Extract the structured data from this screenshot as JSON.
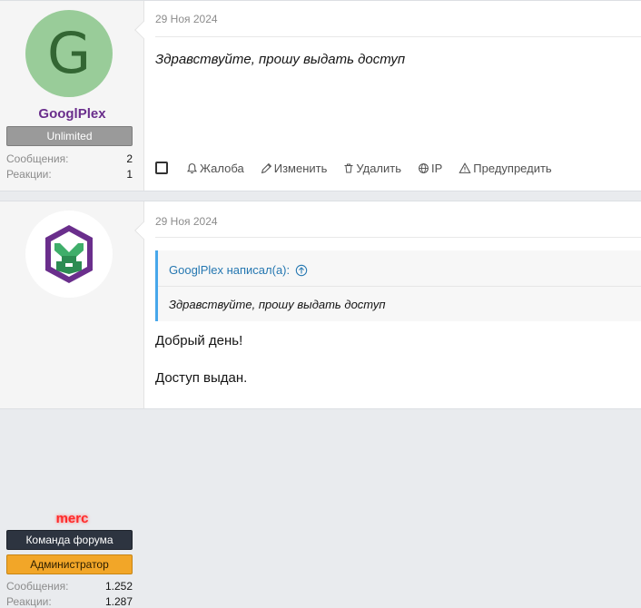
{
  "posts": [
    {
      "user": {
        "avatar_letter": "G",
        "avatar_color": "#99cc99",
        "name": "GooglPlex",
        "name_color": "#6a2e8c",
        "banners": [
          "Unlimited"
        ],
        "stats": [
          {
            "label": "Сообщения:",
            "value": "2"
          },
          {
            "label": "Реакции:",
            "value": "1"
          }
        ]
      },
      "date": "29 Ноя 2024",
      "message": "Здравствуйте, прошу выдать доступ",
      "actions": [
        {
          "icon": "bell-icon",
          "label": "Жалоба"
        },
        {
          "icon": "pencil-icon",
          "label": "Изменить"
        },
        {
          "icon": "trash-icon",
          "label": "Удалить"
        },
        {
          "icon": "globe-icon",
          "label": "IP"
        },
        {
          "icon": "warning-icon",
          "label": "Предупредить"
        }
      ]
    },
    {
      "user": {
        "avatar_icon": "merc-logo",
        "name": "merc",
        "name_color": "#ff2a2a",
        "banners": [
          "Команда форума",
          "Администратор"
        ],
        "stats": [
          {
            "label": "Сообщения:",
            "value": "1.252"
          },
          {
            "label": "Реакции:",
            "value": "1.287"
          }
        ]
      },
      "date": "29 Ноя 2024",
      "quote": {
        "author": "GooglPlex написал(а):",
        "text": "Здравствуйте, прошу выдать доступ"
      },
      "lines": [
        "Добрый день!",
        "Доступ выдан."
      ]
    }
  ]
}
